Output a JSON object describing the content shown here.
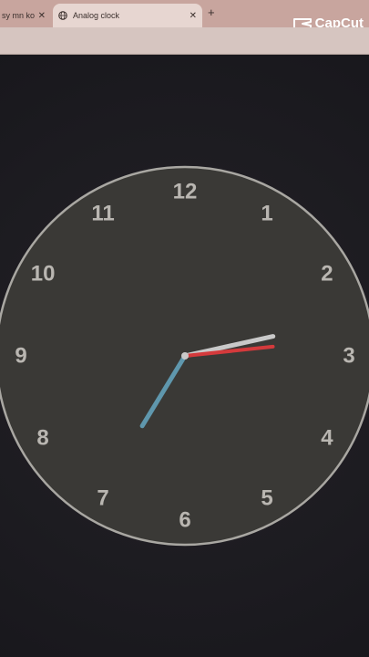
{
  "browser": {
    "tabs": [
      {
        "title": "sy mn ko"
      },
      {
        "title": "Analog clock"
      }
    ],
    "new_tab_symbol": "+",
    "close_symbol": "✕"
  },
  "watermark": {
    "text": "CapCut"
  },
  "clock": {
    "numerals": [
      "12",
      "1",
      "2",
      "3",
      "4",
      "5",
      "6",
      "7",
      "8",
      "9",
      "10",
      "11"
    ],
    "time": {
      "hour": 2,
      "minute": 35,
      "second": 14
    },
    "colors": {
      "face": "#3a3936",
      "rim": "#a9a7a2",
      "hour_hand": "#c9c9c9",
      "minute_hand": "#5f97ad",
      "second_hand": "#d43a3c",
      "numerals": "#b9b6b1"
    }
  }
}
